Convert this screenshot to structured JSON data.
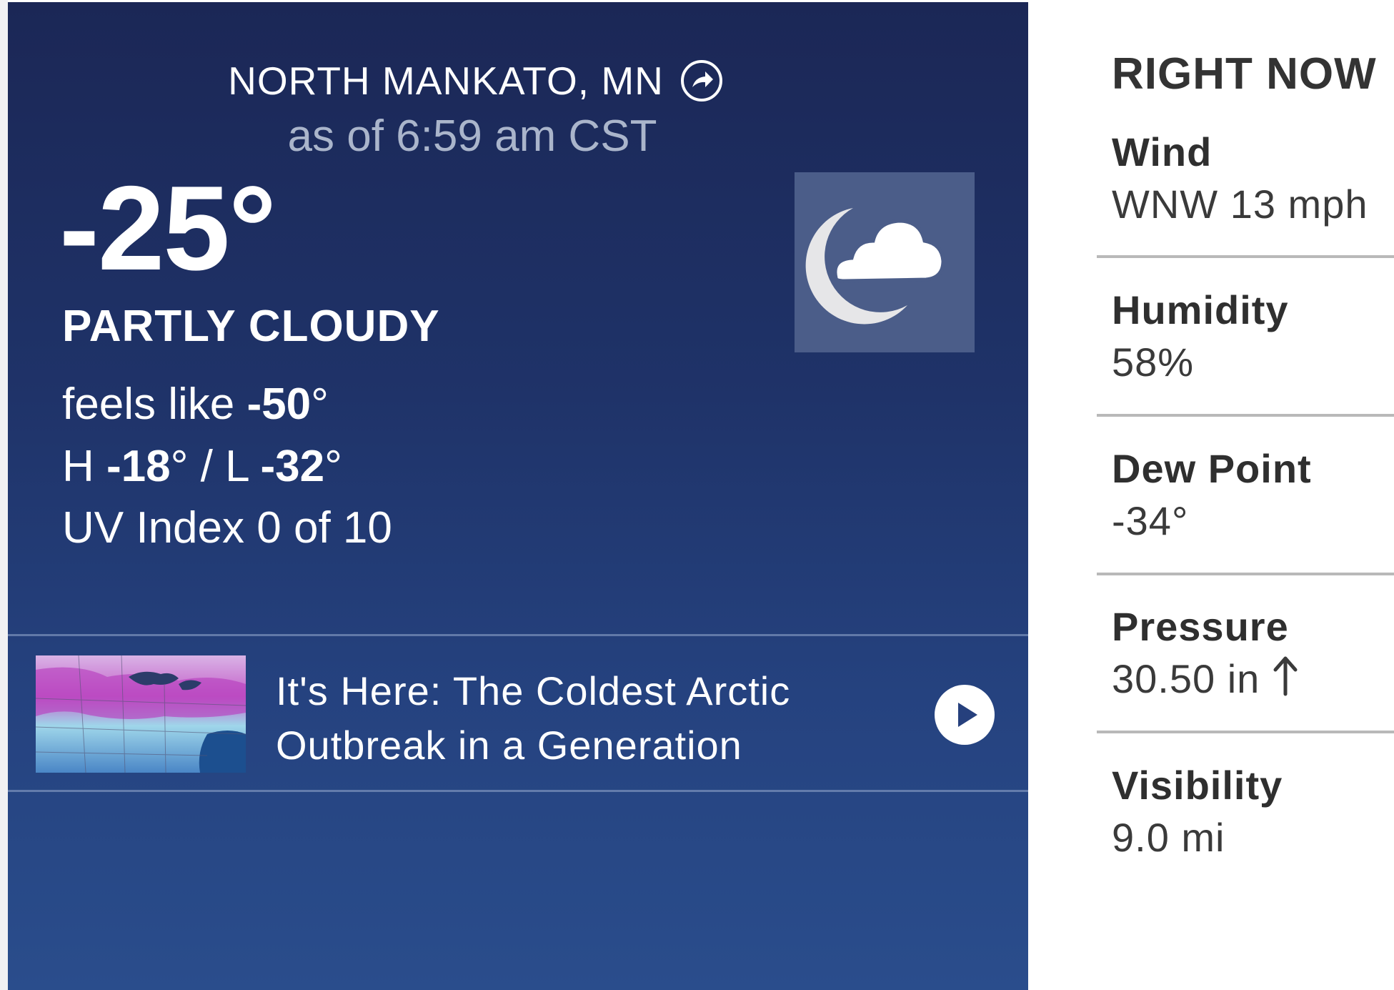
{
  "current": {
    "location": "NORTH MANKATO, MN",
    "as_of": "as of 6:59 am CST",
    "temperature": "-25°",
    "condition": "PARTLY CLOUDY",
    "feels_like_label": "feels like ",
    "feels_like_value": "-50",
    "hilo_h_label": "H ",
    "hilo_h_value": "-18",
    "hilo_sep": " / L ",
    "hilo_l_value": "-32",
    "degree": "°",
    "uv": "UV Index 0 of 10",
    "icon": "moon-cloud-icon"
  },
  "news": {
    "title": "It's Here: The Coldest Arctic Outbreak in a Generation",
    "thumbnail": "arctic-map-thumbnail",
    "action_icon": "play-icon"
  },
  "right_now": {
    "title": "RIGHT NOW",
    "items": [
      {
        "label": "Wind",
        "value": "WNW 13 mph"
      },
      {
        "label": "Humidity",
        "value": "58%"
      },
      {
        "label": "Dew Point",
        "value": "-34°"
      },
      {
        "label": "Pressure",
        "value": "30.50 in",
        "trend_icon": "arrow-up-icon"
      },
      {
        "label": "Visibility",
        "value": "9.0 mi"
      }
    ]
  },
  "colors": {
    "panel_top": "#1b2756",
    "panel_bottom": "#2a4d8c",
    "icon_box": "#4b5d89",
    "muted_text": "#aab5cb"
  }
}
